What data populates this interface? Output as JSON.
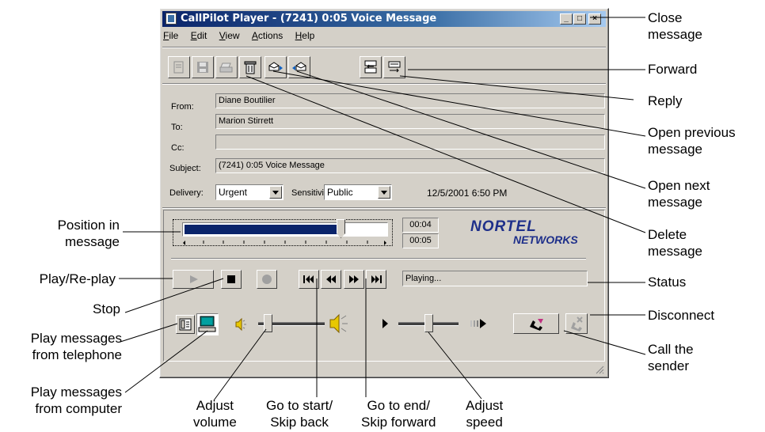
{
  "window": {
    "title": "CallPilot Player - (7241) 0:05 Voice Message",
    "controls": {
      "minimize": "_",
      "maximize": "□",
      "close": "×"
    }
  },
  "menu": [
    "File",
    "Edit",
    "View",
    "Actions",
    "Help"
  ],
  "toolbar": {
    "icons": [
      "properties-icon",
      "save-icon",
      "print-icon",
      "delete-icon",
      "previous-message-icon",
      "next-message-icon",
      "reply-icon",
      "forward-icon"
    ]
  },
  "header": {
    "from_label": "From:",
    "from": "Diane Boutilier",
    "to_label": "To:",
    "to": "Marion Stirrett",
    "cc_label": "Cc:",
    "cc": "",
    "subject_label": "Subject:",
    "subject": "(7241) 0:05 Voice Message",
    "delivery_label": "Delivery:",
    "delivery": "Urgent",
    "sensitivity_label": "Sensitivity:",
    "sensitivity": "Public",
    "timestamp": "12/5/2001 6:50 PM"
  },
  "player": {
    "position_time": "00:04",
    "total_time": "00:05",
    "position_fraction": 0.8,
    "status": "Playing...",
    "logo_line1": "NORTEL",
    "logo_line2": "NETWORKS",
    "volume_fraction": 0.1,
    "speed_fraction": 0.5
  },
  "callouts": {
    "close_message": "Close\nmessage",
    "forward": "Forward",
    "reply": "Reply",
    "open_previous": "Open previous\nmessage",
    "open_next": "Open next\nmessage",
    "delete_message": "Delete\nmessage",
    "status": "Status",
    "disconnect": "Disconnect",
    "call_sender": "Call the\nsender",
    "position": "Position in\nmessage",
    "play": "Play/Re-play",
    "stop": "Stop",
    "play_telephone": "Play messages\nfrom telephone",
    "play_computer": "Play messages\nfrom computer",
    "adjust_volume": "Adjust\nvolume",
    "go_start": "Go to start/\nSkip back",
    "go_end": "Go to end/\nSkip forward",
    "adjust_speed": "Adjust\nspeed"
  },
  "colors": {
    "title_start": "#0a246a",
    "title_end": "#a6caf0",
    "window_bg": "#d4d0c8",
    "progress": "#0a246a",
    "logo": "#1e2f8a"
  }
}
